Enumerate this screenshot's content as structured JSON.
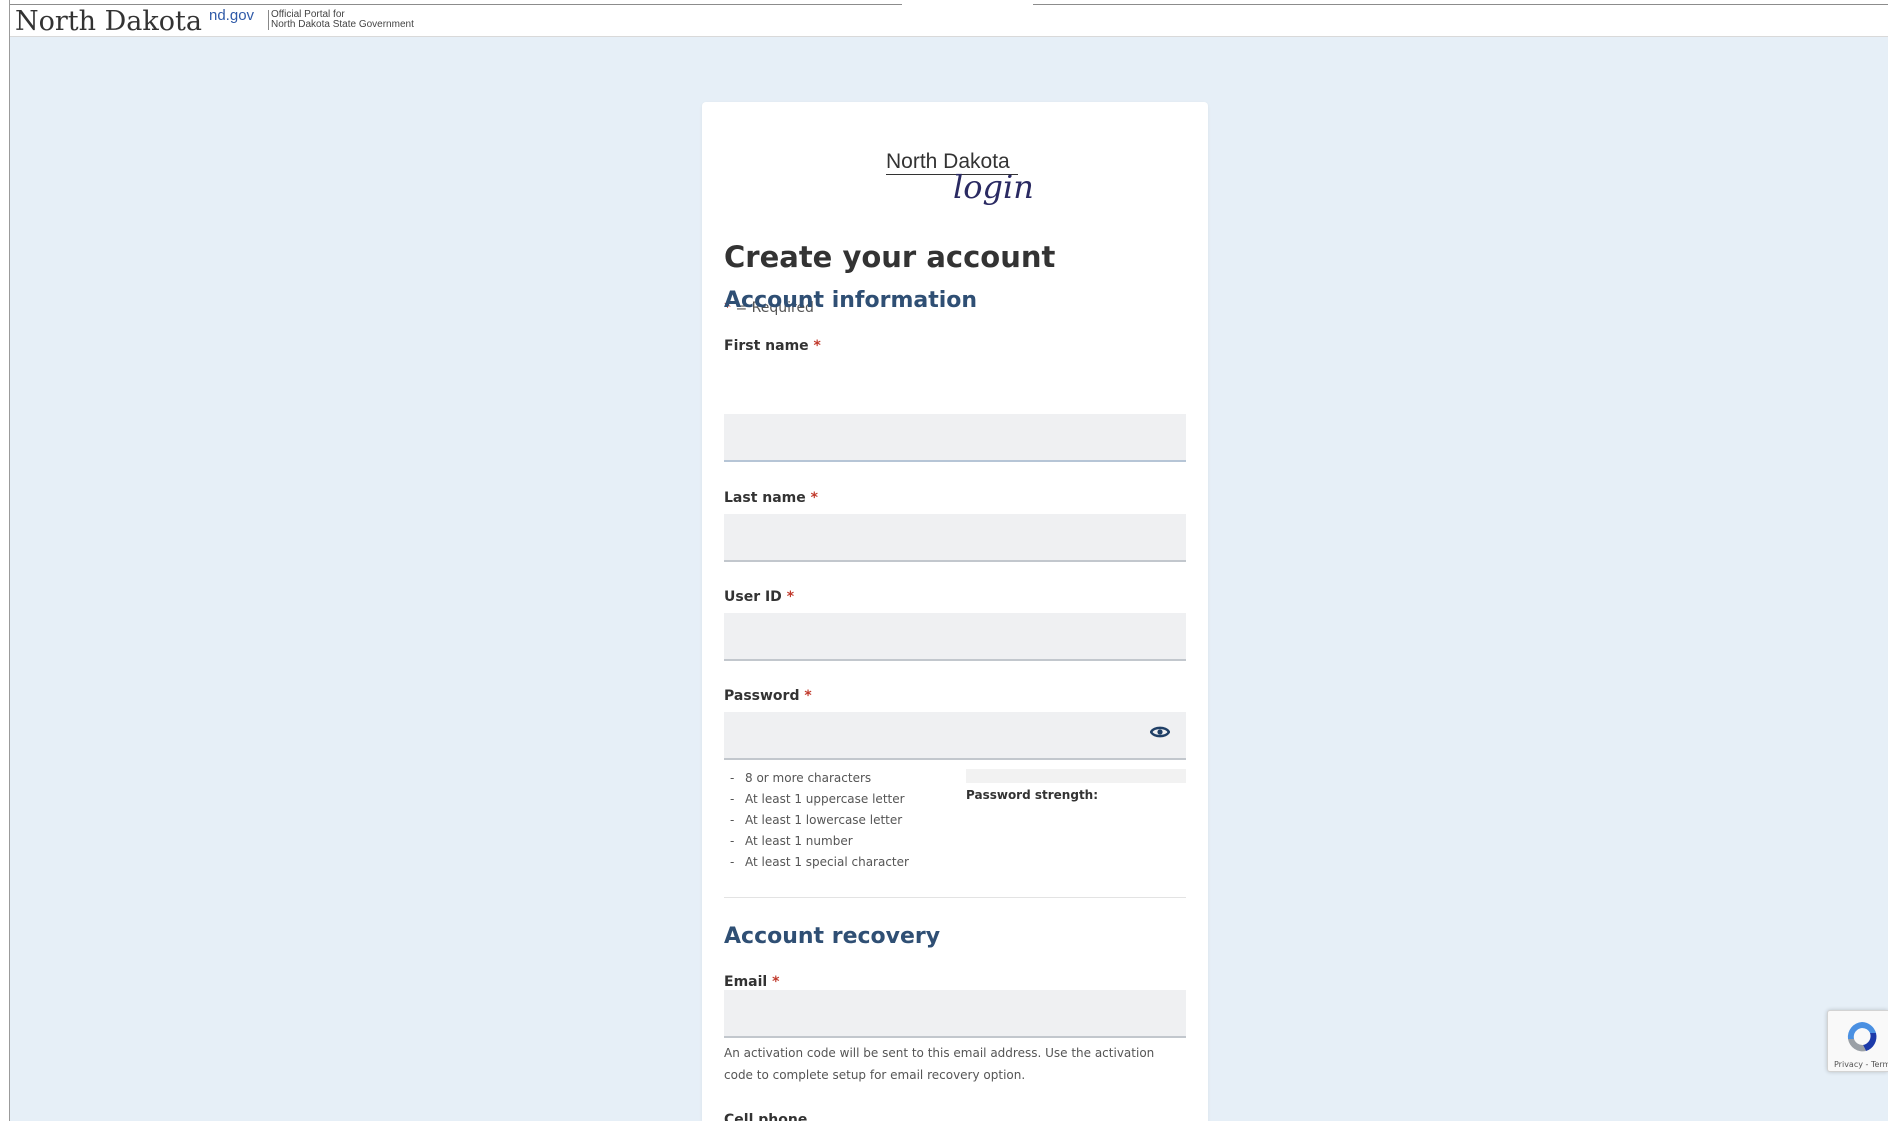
{
  "header": {
    "brand": "North Dakota",
    "ndgov": "nd.gov",
    "portal_line1": "Official Portal for",
    "portal_line2": "North Dakota State Government"
  },
  "logo": {
    "top": "North Dakota",
    "bottom": "login"
  },
  "form": {
    "title": "Create your account",
    "required_asterisk": "*",
    "required_text": " = Required",
    "account_info_heading": "Account information",
    "first_name_label": "First name",
    "last_name_label": "Last name",
    "user_id_label": "User ID",
    "password_label": "Password",
    "password_rules": [
      "8 or more characters",
      "At least 1 uppercase letter",
      "At least 1 lowercase letter",
      "At least 1 number",
      "At least 1 special character"
    ],
    "rule_dash": "-",
    "password_strength_label": "Password strength:",
    "account_recovery_heading": "Account recovery",
    "email_label": "Email",
    "email_helper": "An activation code will be sent to this email address. Use the activation code to complete setup for email recovery option.",
    "cell_phone_label": "Cell phone",
    "required_marker": "*"
  },
  "recaptcha": {
    "text": "Privacy - Terms"
  },
  "colors": {
    "page_bg": "#e6eff7",
    "heading_blue": "#2f4f74",
    "required_red": "#c0392b",
    "eye_icon": "#1f3f66"
  },
  "icons": {
    "password_toggle": "eye-icon",
    "captcha": "recaptcha-logo-icon"
  }
}
